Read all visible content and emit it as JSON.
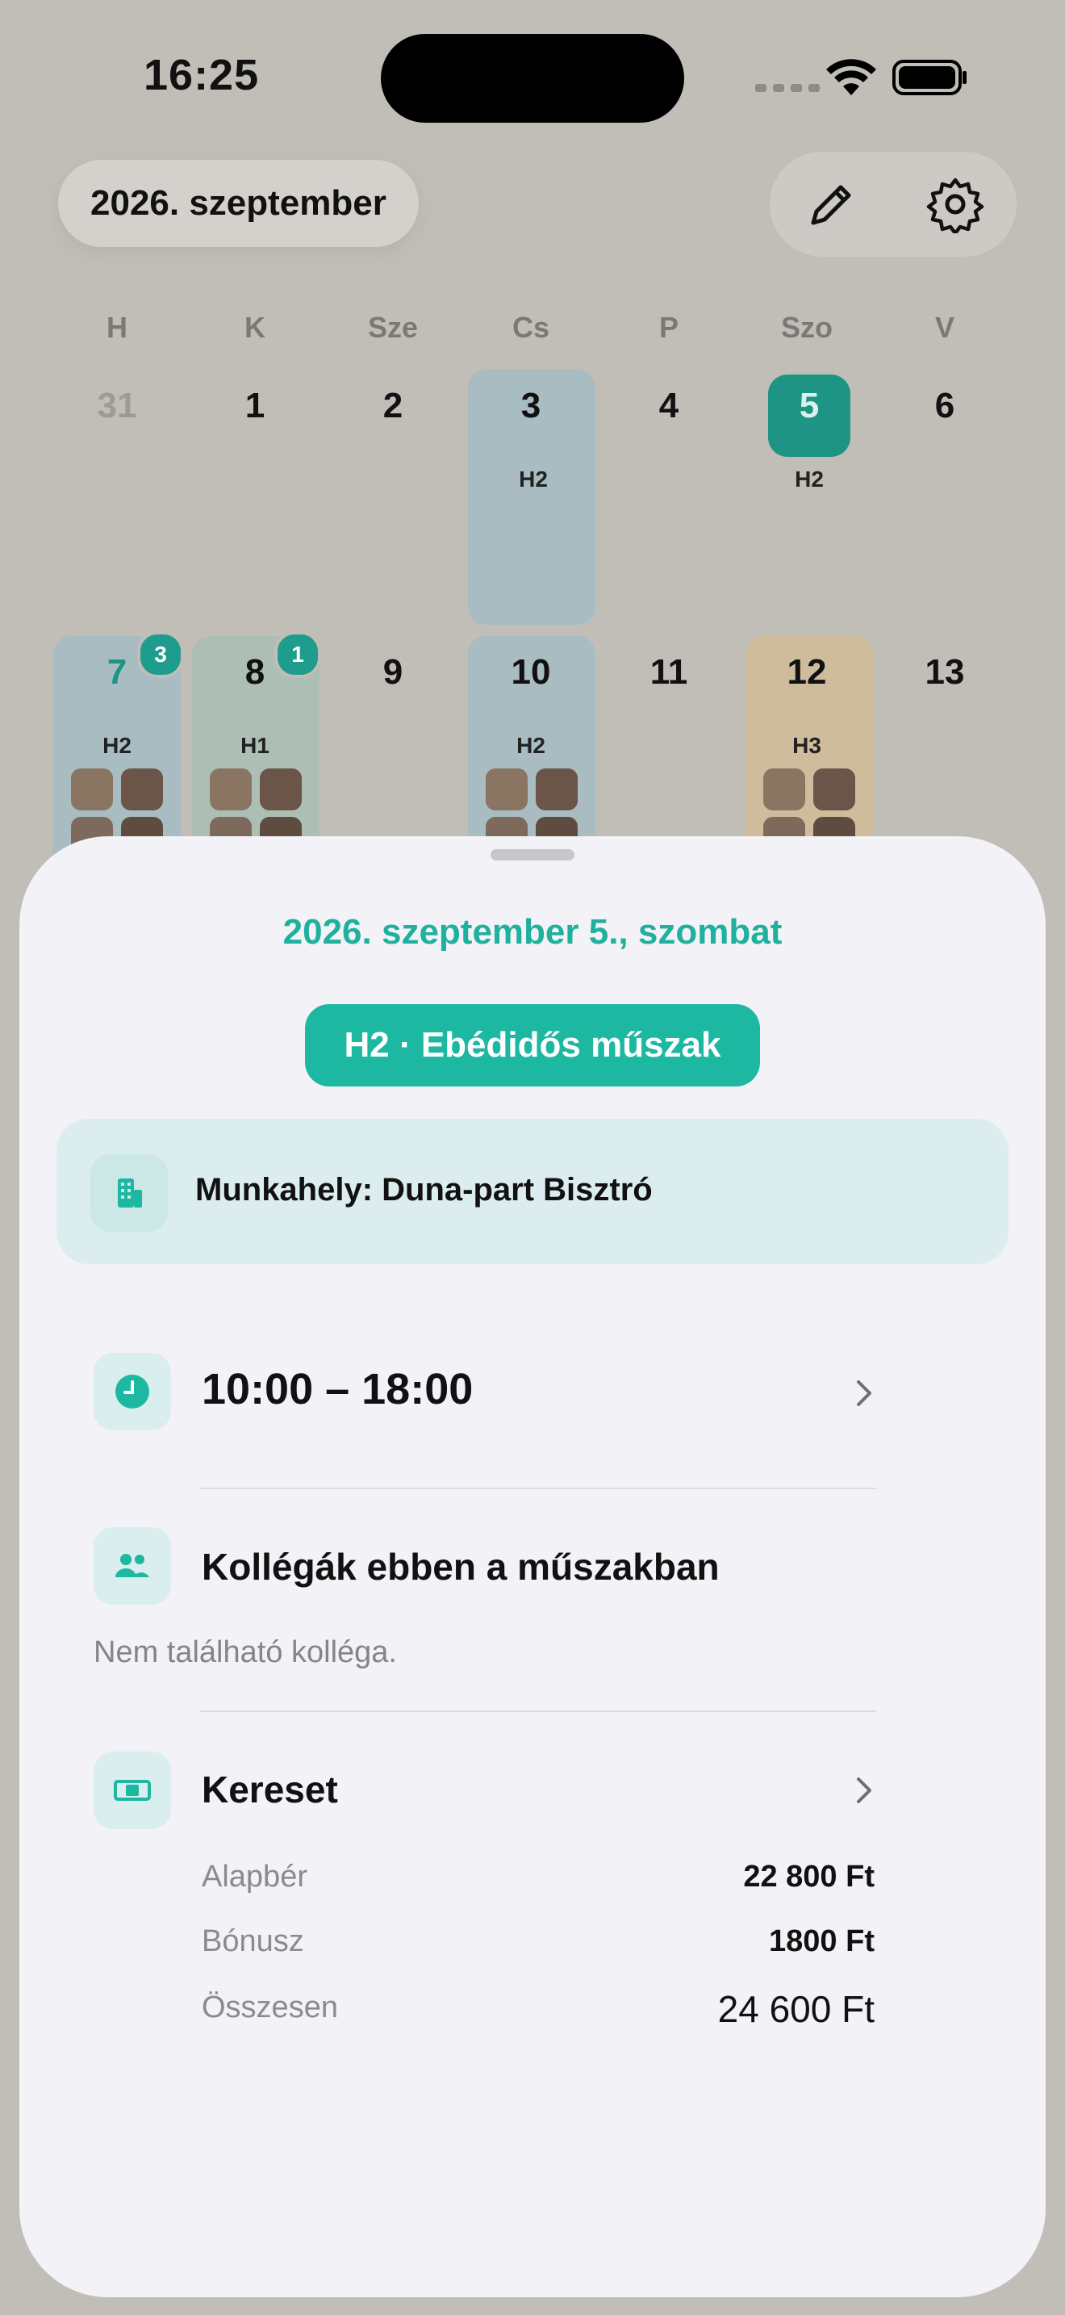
{
  "status_bar": {
    "time": "16:25"
  },
  "header": {
    "month_label": "2026. szeptember"
  },
  "calendar": {
    "weekdays": [
      "H",
      "K",
      "Sze",
      "Cs",
      "P",
      "Szo",
      "V"
    ],
    "week1": [
      "31",
      "1",
      "2",
      "3",
      "4",
      "5",
      "6"
    ],
    "week2": [
      "7",
      "8",
      "9",
      "10",
      "11",
      "12",
      "13"
    ],
    "shift_labels": {
      "d3": "H2",
      "d5": "H2",
      "d7": "H2",
      "d8": "H1",
      "d10": "H2",
      "d12": "H3"
    },
    "badges": {
      "d7": "3",
      "d8": "1"
    }
  },
  "detail": {
    "date_title": "2026. szeptember 5., szombat",
    "shift_chip": "H2 · Ebédidős műszak",
    "workplace": "Munkahely: Duna-part Bisztró",
    "time_range": "10:00 – 18:00",
    "colleagues_title": "Kollégák ebben a műszakban",
    "colleagues_empty": "Nem található kolléga.",
    "earnings_title": "Kereset",
    "base_label": "Alapbér",
    "base_value": "22 800 Ft",
    "bonus_label": "Bónusz",
    "bonus_value": "1800 Ft",
    "total_label": "Összesen",
    "total_value": "24 600 Ft"
  },
  "colors": {
    "accent": "#1db8a1",
    "accent_dark": "#1e9484",
    "shift_h2_bg": "#a9bcc1",
    "shift_h1_bg": "#adbfb5",
    "shift_h3_bg": "#cfbc9d"
  }
}
